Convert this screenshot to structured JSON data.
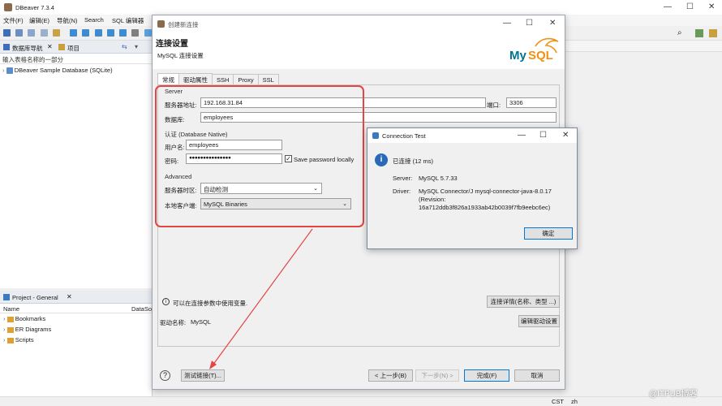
{
  "app": {
    "title": "DBeaver 7.3.4",
    "menu": [
      "文件(F)",
      "编辑(E)",
      "导航(N)",
      "Search",
      "SQL 编辑器"
    ]
  },
  "navigator": {
    "tabs": [
      "数据库导航",
      "项目"
    ],
    "filter_placeholder": "输入表格名称的一部分",
    "tree_item": "DBeaver Sample Database (SQLite)"
  },
  "project": {
    "title": "Project - General",
    "col_name": "Name",
    "col_datasource": "DataSo",
    "items": [
      "Bookmarks",
      "ER Diagrams",
      "Scripts"
    ]
  },
  "status": {
    "cst": "CST",
    "lang": "zh"
  },
  "watermark": "@ITPUB博客",
  "dialog": {
    "window_title": "创建新连接",
    "heading": "连接设置",
    "subheading": "MySQL 连接设置",
    "logo_text": "MySQL",
    "tabs": [
      "常规",
      "驱动属性",
      "SSH",
      "Proxy",
      "SSL"
    ],
    "server_group": "Server",
    "host_label": "服务器地址:",
    "host_value": "192.168.31.84",
    "port_label": "端口:",
    "port_value": "3306",
    "db_label": "数据库:",
    "db_value": "employees",
    "auth_group": "认证 (Database Native)",
    "user_label": "用户名:",
    "user_value": "employees",
    "pass_label": "密码:",
    "pass_value": "●●●●●●●●●●●●●●●",
    "save_password_label": "Save password locally",
    "save_password_checked": true,
    "advanced_group": "Advanced",
    "timezone_label": "服务器时区:",
    "timezone_value": "自动检测",
    "client_label": "本地客户端:",
    "client_value": "MySQL Binaries",
    "info_text": "可以在连接参数中使用变量.",
    "conn_detail_button": "连接详情(名称、类型 ...)",
    "driver_label": "驱动名称:",
    "driver_value": "MySQL",
    "edit_driver_button": "编辑驱动设置",
    "test_button": "测试链接(T)...",
    "back_button": "< 上一步(B)",
    "next_button": "下一步(N) >",
    "finish_button": "完成(F)",
    "cancel_button": "取消"
  },
  "conn_test": {
    "title": "Connection Test",
    "message": "已连接 (12 ms)",
    "server_label": "Server:",
    "server_value": "MySQL 5.7.33",
    "driver_label": "Driver:",
    "driver_line1": "MySQL Connector/J mysql-connector-java-8.0.17",
    "driver_line2": "(Revision:",
    "driver_line3": "16a712ddb3f826a1933ab42b0039f7fb9eebc6ec)",
    "ok_button": "确定"
  },
  "colors": {
    "accent": "#0078d7",
    "highlight_box": "#e34444",
    "mysql_blue": "#00758f",
    "mysql_orange": "#f29111"
  }
}
